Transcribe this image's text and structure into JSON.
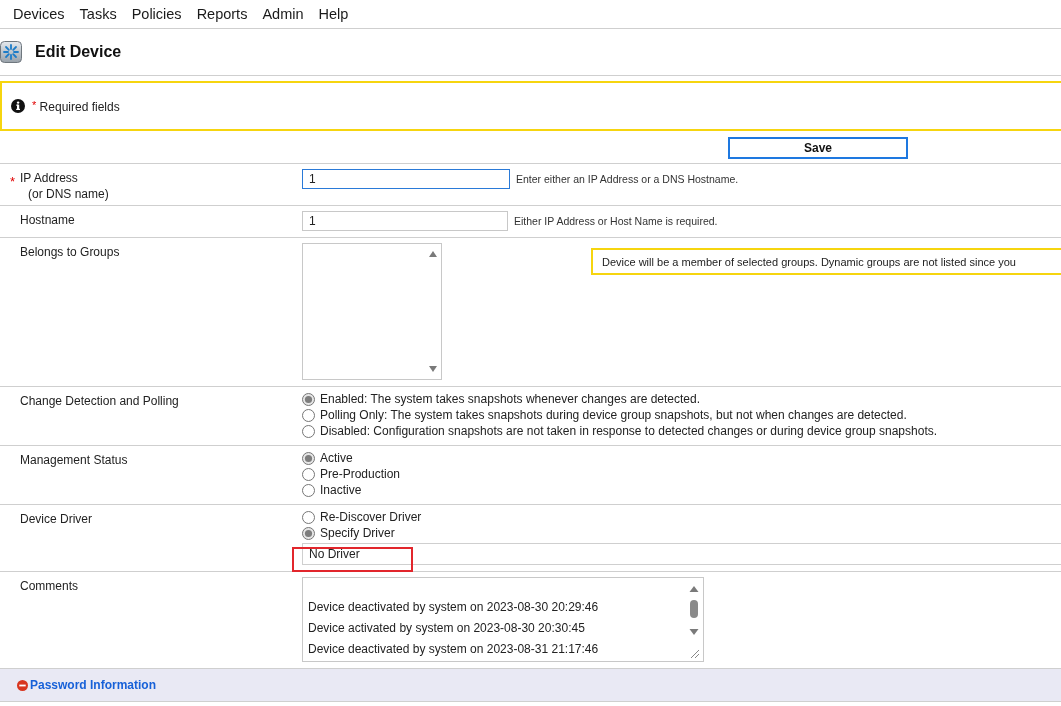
{
  "menu": [
    "Devices",
    "Tasks",
    "Policies",
    "Reports",
    "Admin",
    "Help"
  ],
  "page_title": "Edit Device",
  "notice": {
    "mark": "*",
    "text": "Required fields"
  },
  "save_button": "Save",
  "form": [
    {
      "kind": "text",
      "label": "IP Address",
      "required_mark": "*",
      "sublabel": "(or DNS name)",
      "value": "1",
      "focused": true,
      "hint": "Enter either an IP Address or a DNS Hostname."
    },
    {
      "kind": "text",
      "label": "Hostname",
      "value": "1",
      "focused": false,
      "hint": "Either IP Address or Host Name is required."
    },
    {
      "kind": "listbox",
      "label": "Belongs to Groups",
      "note": "Device will be a member of selected groups. Dynamic groups are not listed since you"
    },
    {
      "kind": "radio",
      "label": "Change Detection and Polling",
      "options": [
        {
          "label": "Enabled: The system takes snapshots whenever changes are detected.",
          "selected": true
        },
        {
          "label": "Polling Only: The system takes snapshots during device group snapshots, but not when changes are detected.",
          "selected": false
        },
        {
          "label": "Disabled: Configuration snapshots are not taken in response to detected changes or during device group snapshots.",
          "selected": false
        }
      ]
    },
    {
      "kind": "radio",
      "label": "Management Status",
      "options": [
        {
          "label": "Active",
          "selected": true
        },
        {
          "label": "Pre-Production",
          "selected": false
        },
        {
          "label": "Inactive",
          "selected": false
        }
      ]
    },
    {
      "kind": "radio",
      "label": "Device Driver",
      "options": [
        {
          "label": "Re-Discover Driver",
          "selected": false
        },
        {
          "label": "Specify Driver",
          "selected": true
        }
      ],
      "driver_field": {
        "value": "No Driver",
        "highlighted": true
      }
    },
    {
      "kind": "textarea",
      "label": "Comments",
      "lines": [
        "Device deactivated by system on 2023-08-30 20:29:46",
        "Device activated by system on 2023-08-30 20:30:45",
        "Device deactivated by system on 2023-08-31 21:17:46"
      ]
    }
  ],
  "section": {
    "label": "Password Information",
    "expanded": true
  }
}
